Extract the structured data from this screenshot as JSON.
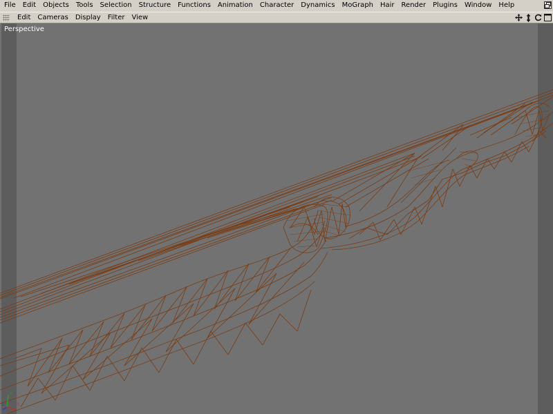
{
  "menu": {
    "items": [
      "File",
      "Edit",
      "Objects",
      "Tools",
      "Selection",
      "Structure",
      "Functions",
      "Animation",
      "Character",
      "Dynamics",
      "MoGraph",
      "Hair",
      "Render",
      "Plugins",
      "Window",
      "Help"
    ]
  },
  "view_menu": {
    "items": [
      "Edit",
      "Cameras",
      "Display",
      "Filter",
      "View"
    ]
  },
  "viewport": {
    "label": "Perspective",
    "background": "#727272",
    "wire_color": "#7a3c14",
    "safe_frame_color": "#5d5d5d"
  },
  "nav_icons": [
    "move-view-icon",
    "zoom-view-icon",
    "rotate-view-icon",
    "maximize-view-icon"
  ],
  "axis_icon": {
    "x_label": "X",
    "y_label": "Y",
    "z_label": "Z"
  }
}
